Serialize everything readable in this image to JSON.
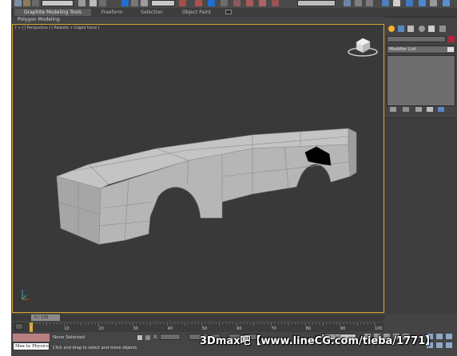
{
  "ribbon": {
    "tabs": [
      "Graphite Modeling Tools",
      "Freeform",
      "Selection",
      "Object Paint"
    ],
    "panel_label": "Polygon Modeling"
  },
  "viewport": {
    "label_parts": [
      "[ + ]",
      "[ Perspective ]",
      "[ Realistic + Edged Faces ]"
    ]
  },
  "command_panel": {
    "modifier_list": "Modifier List"
  },
  "timeline": {
    "frame": "0 / 100",
    "ticks": [
      "0",
      "10",
      "20",
      "30",
      "40",
      "50",
      "60",
      "70",
      "80",
      "90",
      "100"
    ]
  },
  "status": {
    "maxscript_label": "Max to Physics",
    "selection_info": "None Selected",
    "prompt": "Click and drag to select and move objects",
    "x_label": "X:",
    "selected_dropdown": "Selected"
  },
  "watermark": {
    "text": "3Dmax吧【www.lineCG.com/tieba/1771】"
  },
  "colors": {
    "viewport_border": "#d8a82c",
    "active_ribbon_tab": "#5a5a5a",
    "selection_highlight": "#1e6fd0"
  }
}
